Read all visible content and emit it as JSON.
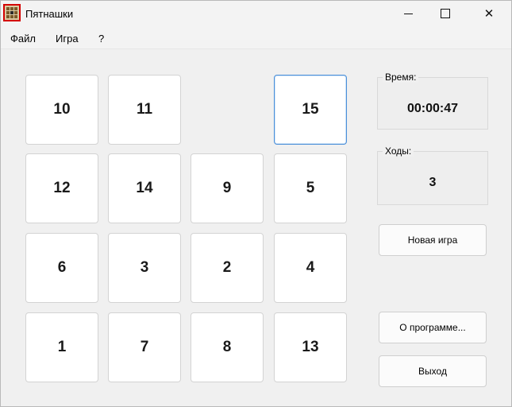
{
  "window": {
    "title": "Пятнашки"
  },
  "menu": {
    "file": "Файл",
    "game": "Игра",
    "help": "?"
  },
  "board": {
    "tiles": [
      [
        "10",
        "11",
        "",
        "15"
      ],
      [
        "12",
        "14",
        "9",
        "5"
      ],
      [
        "6",
        "3",
        "2",
        "4"
      ],
      [
        "1",
        "7",
        "8",
        "13"
      ]
    ],
    "selected": "15"
  },
  "stats": {
    "time_label": "Время:",
    "time_value": "00:00:47",
    "moves_label": "Ходы:",
    "moves_value": "3"
  },
  "buttons": {
    "new_game": "Новая игра",
    "about": "О программе...",
    "exit": "Выход"
  },
  "colors": {
    "selected_border": "#4a8fd9",
    "icon_highlight": "#d40000"
  }
}
